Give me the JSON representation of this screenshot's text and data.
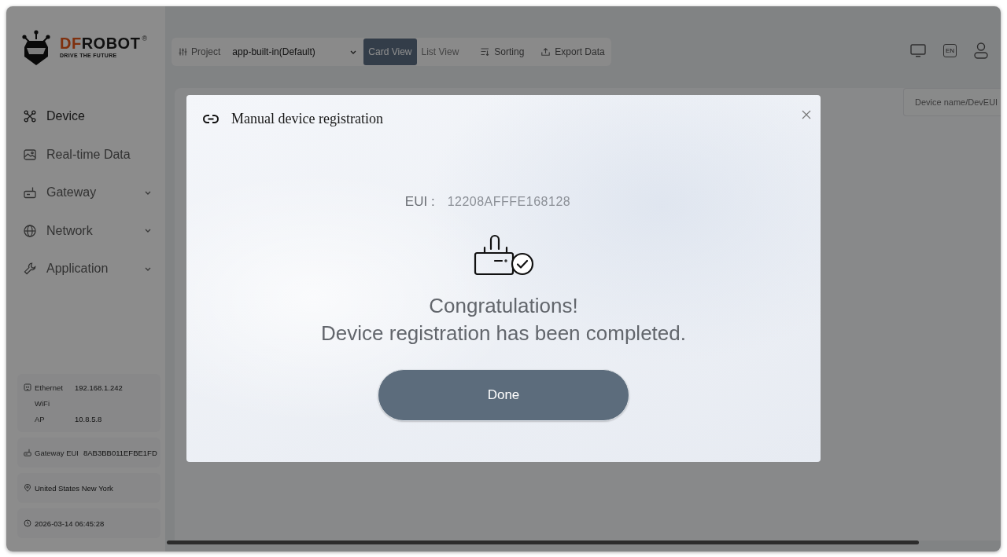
{
  "brand": {
    "prefix": "DF",
    "name": "ROBOT",
    "registered": "®",
    "tagline": "DRIVE THE FUTURE"
  },
  "toolbar": {
    "project_label": "Project",
    "project_select": "app-built-in(Default)",
    "views": [
      {
        "label": "Card View",
        "selected": true
      },
      {
        "label": "List View",
        "selected": false
      }
    ],
    "actions": [
      {
        "label": "Sorting",
        "kind": "sort"
      },
      {
        "label": "Export Data",
        "kind": "export"
      }
    ]
  },
  "header": {
    "language": "EN"
  },
  "sidebar": {
    "items": [
      {
        "label": "Device",
        "kind": "link",
        "selected": true
      },
      {
        "label": "Real-time Data",
        "kind": "link",
        "selected": false
      },
      {
        "label": "Gateway",
        "kind": "group",
        "selected": false
      },
      {
        "label": "Network",
        "kind": "group",
        "selected": false
      },
      {
        "label": "Application",
        "kind": "group",
        "selected": false
      }
    ],
    "network_info": [
      {
        "label": "Ethernet",
        "value": "192.168.1.242"
      },
      {
        "label": "WiFi"
      },
      {
        "label": "AP",
        "value": "10.8.5.8"
      }
    ],
    "gateway_eui": {
      "label": "Gateway EUI",
      "value": "8AB3BB011EFBE1FD"
    },
    "location": "United States New York",
    "datetime": "2026-03-14 06:45:28"
  },
  "search": {
    "placeholder": "Device name/DevEUI"
  },
  "dialog": {
    "title": "Manual device registration",
    "eui_label": "EUI :",
    "eui_value": "12208AFFFE168128",
    "heading": "Congratulations!",
    "message": "Device registration has been completed.",
    "button": "Done"
  }
}
